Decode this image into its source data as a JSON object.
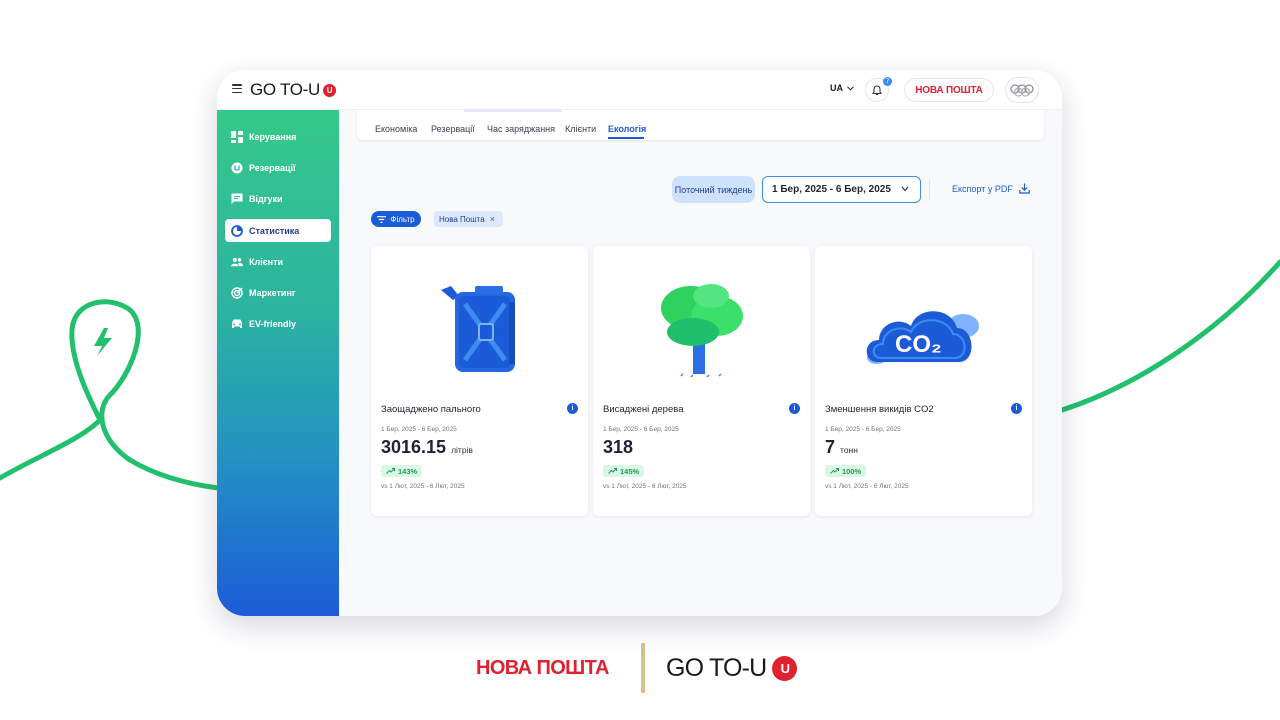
{
  "app": {
    "brand": "GO TO-U",
    "brand_badge": "U",
    "language": "UA",
    "notifications_count": "7",
    "partner": "НОВА ПОШТА"
  },
  "sidebar": {
    "items": [
      {
        "label": "Керування",
        "icon": "dashboard-icon"
      },
      {
        "label": "Резервації",
        "icon": "reservation-icon"
      },
      {
        "label": "Відгуки",
        "icon": "reviews-icon"
      },
      {
        "label": "Статистика",
        "icon": "statistics-icon",
        "active": true
      },
      {
        "label": "Клієнти",
        "icon": "clients-icon"
      },
      {
        "label": "Маркетинг",
        "icon": "marketing-icon"
      },
      {
        "label": "EV-friendly",
        "icon": "ev-friendly-icon"
      }
    ]
  },
  "tabs": [
    "Економіка",
    "Резервації",
    "Час заряджання",
    "Клієнти",
    "Екологія"
  ],
  "active_tab": "Екологія",
  "toolbar": {
    "period_label": "Поточний тиждень",
    "date_range": "1 Бер, 2025 - 6 Бер, 2025",
    "export_label": "Експорт у PDF",
    "filter_label": "Фільтр",
    "filter_chip": "Нова Пошта"
  },
  "cards": [
    {
      "title": "Заощаджено пального",
      "range": "1 Бер, 2025 - 6 Бер, 2025",
      "value": "3016.15",
      "unit": "літрів",
      "delta": "143%",
      "compare": "vs 1 Лют, 2025 - 6 Лют, 2025",
      "icon": "jerrycan-icon"
    },
    {
      "title": "Висаджені дерева",
      "range": "1 Бер, 2025 - 6 Бер, 2025",
      "value": "318",
      "unit": "",
      "delta": "145%",
      "compare": "vs 1 Лют, 2025 - 6 Лют, 2025",
      "icon": "tree-icon"
    },
    {
      "title": "Зменшення викидів CO2",
      "range": "1 Бер, 2025 - 6 Бер, 2025",
      "value": "7",
      "unit": "тонн",
      "delta": "100%",
      "compare": "vs 1 Лют, 2025 - 6 Лют, 2025",
      "icon": "co2-cloud-icon",
      "icon_text": "CO₂"
    }
  ],
  "footer": {
    "partner_logo": "НОВА ПОШТА",
    "brand_logo": "GO TO-U",
    "brand_badge": "U"
  },
  "colors": {
    "accent": "#1c5bd8",
    "brand_red": "#e0212f",
    "green": "#1fbf6b"
  }
}
